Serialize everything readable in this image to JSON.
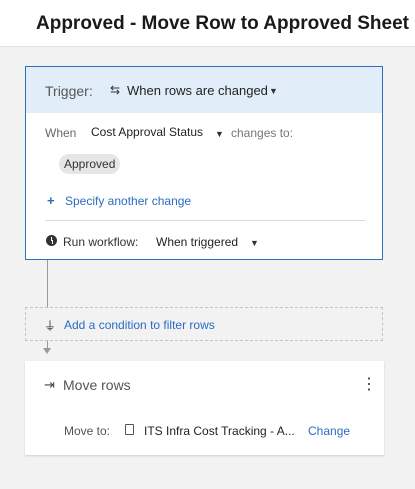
{
  "header": {
    "title": "Approved - Move Row to Approved Sheet"
  },
  "trigger": {
    "label": "Trigger:",
    "value": "When rows are changed",
    "condition": {
      "when_label": "When",
      "field": "Cost Approval Status",
      "changes_to_label": "changes to:",
      "chip": "Approved"
    },
    "specify_link": "Specify another change",
    "run_workflow_label": "Run workflow:",
    "run_workflow_value": "When triggered"
  },
  "condition_block": {
    "text": "Add a condition to filter rows"
  },
  "action": {
    "title": "Move rows",
    "move_to_label": "Move to:",
    "sheet_name": "ITS Infra Cost Tracking - A...",
    "change_link": "Change"
  },
  "colors": {
    "accent": "#2b6cc4",
    "trigger_header_bg": "#e1eefa",
    "trigger_border": "#2c6fbf",
    "canvas_bg": "#f2f2f2"
  },
  "icons": {
    "change": "arrows-cycle-icon",
    "caret": "caret-down-icon",
    "plus": "plus-icon",
    "clock": "clock-icon",
    "filter": "filter-icon",
    "move": "move-rows-icon",
    "menu": "kebab-menu-icon",
    "sheet": "sheet-icon"
  }
}
